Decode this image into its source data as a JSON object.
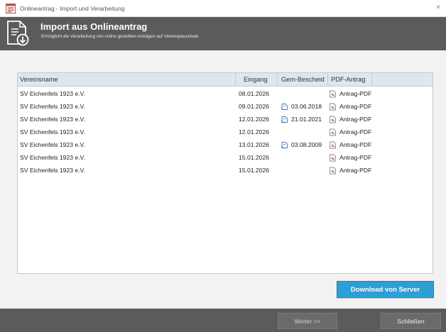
{
  "window": {
    "title": "Onlineantrag - Import und Verarbeitung",
    "close_glyph": "×"
  },
  "header": {
    "title": "Import aus Onlineantrag",
    "subtitle": "Ermöglicht die Verarbeitung von online gestellten Anträgen auf Vereinspauschale",
    "icon": "import-document-icon"
  },
  "grid": {
    "columns": [
      "Vereinsname",
      "Eingang",
      "Gem-Bescheid",
      "PDF-Antrag"
    ],
    "rows": [
      {
        "name": "SV Eichenfels 1923 e.V.",
        "eingang": "08.01.2026",
        "bescheid": "",
        "pdf": "Antrag-PDF"
      },
      {
        "name": "SV Eichenfels 1923 e.V.",
        "eingang": "09.01.2026",
        "bescheid": "03.06.2018",
        "pdf": "Antrag-PDF"
      },
      {
        "name": "SV Eichenfels 1923 e.V.",
        "eingang": "12.01.2026",
        "bescheid": "21.01.2021",
        "pdf": "Antrag-PDF"
      },
      {
        "name": "SV Eichenfels 1923 e.V.",
        "eingang": "12.01.2026",
        "bescheid": "",
        "pdf": "Antrag-PDF"
      },
      {
        "name": "SV Eichenfels 1923 e.V.",
        "eingang": "13.01.2026",
        "bescheid": "03.08.2009",
        "pdf": "Antrag-PDF"
      },
      {
        "name": "SV Eichenfels 1923 e.V.",
        "eingang": "15.01.2026",
        "bescheid": "",
        "pdf": "Antrag-PDF"
      },
      {
        "name": "SV Eichenfels 1923 e.V.",
        "eingang": "15.01.2026",
        "bescheid": "",
        "pdf": "Antrag-PDF"
      }
    ]
  },
  "buttons": {
    "download": "Download von Server",
    "weiter": "Weiter >>",
    "schliessen": "Schließen"
  },
  "colors": {
    "header_bg": "#5b5b5b",
    "accent": "#2e9fd6",
    "grid_header_bg": "#dfe6f0"
  }
}
